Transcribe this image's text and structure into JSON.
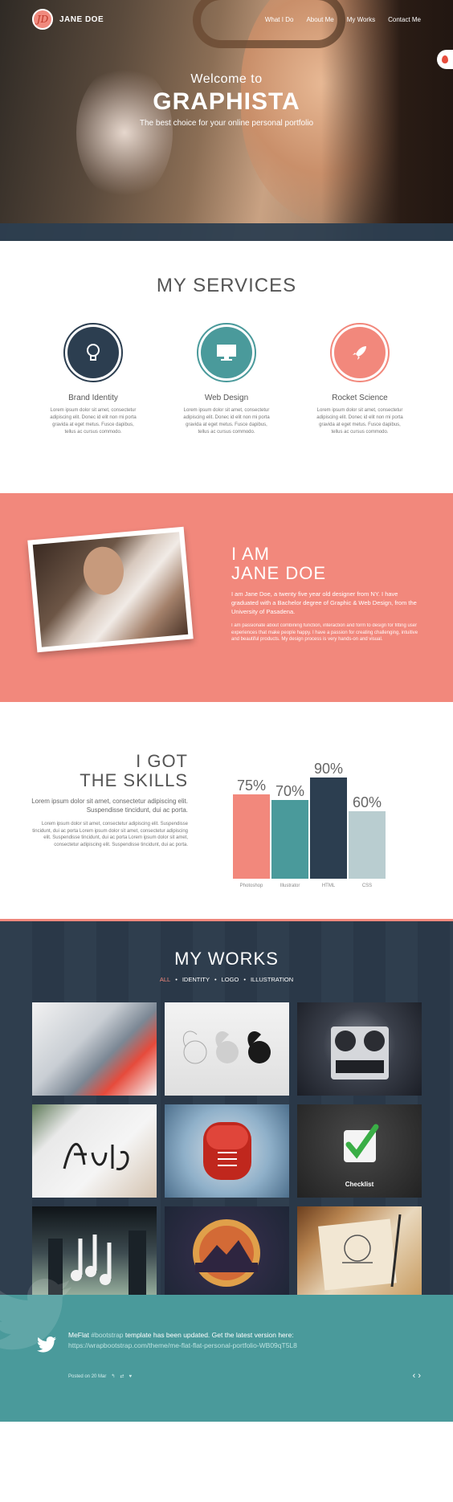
{
  "nav": {
    "logo_initials": "JD",
    "brand": "JANE DOE",
    "items": [
      "What I Do",
      "About Me",
      "My Works",
      "Contact Me"
    ]
  },
  "hero": {
    "welcome": "Welcome to",
    "title": "GRAPHISTA",
    "subtitle": "The best choice for your online personal portfolio"
  },
  "services": {
    "title": "MY SERVICES",
    "items": [
      {
        "label": "Brand Identity",
        "icon": "lightbulb-icon",
        "color": "#2c3e50",
        "text": "Lorem ipsum dolor sit amet, consectetur adipiscing elit. Donec id elit non mi porta gravida at eget metus. Fusce dapibus, tellus ac cursus commodo."
      },
      {
        "label": "Web Design",
        "icon": "monitor-icon",
        "color": "#4a9a9b",
        "text": "Lorem ipsum dolor sit amet, consectetur adipiscing elit. Donec id elit non mi porta gravida at eget metus. Fusce dapibus, tellus ac cursus commodo."
      },
      {
        "label": "Rocket Science",
        "icon": "rocket-icon",
        "color": "#f2887c",
        "text": "Lorem ipsum dolor sit amet, consectetur adipiscing elit. Donec id elit non mi porta gravida at eget metus. Fusce dapibus, tellus ac cursus commodo."
      }
    ]
  },
  "about": {
    "heading_1": "I AM",
    "heading_2": "JANE DOE",
    "p1": "I am Jane Doe, a twenty five year old designer from NY. I have graduated with a Bachelor degree of Graphic & Web Design, from the University of Pasadena.",
    "p2": "I am passionate about combining function, interaction and form to design for fitting user experiences that make people happy. I have a passion for creating challenging, intuitive and beautiful products. My design process is very hands-on and visual."
  },
  "skills": {
    "heading_1": "I GOT",
    "heading_2": "THE SKILLS",
    "p1": "Lorem ipsum dolor sit amet, consectetur adipiscing elit. Suspendisse tincidunt, dui ac porta.",
    "p2": "Lorem ipsum dolor sit amet, consectetur adipiscing elit. Suspendisse tincidunt, dui ac porta Lorem ipsum dolor sit amet, consectetur adipiscing elit. Suspendisse tincidunt, dui ac porta Lorem ipsum dolor sit amet, consectetur adipiscing elit. Suspendisse tincidunt, dui ac porta."
  },
  "chart_data": {
    "type": "bar",
    "categories": [
      "Photoshop",
      "Illustrator",
      "HTML",
      "CSS"
    ],
    "values": [
      75,
      70,
      90,
      60
    ],
    "value_labels": [
      "75%",
      "70%",
      "90%",
      "60%"
    ],
    "colors": [
      "#f2887c",
      "#4a9a9b",
      "#2c3e50",
      "#b9cdd0"
    ],
    "ylim": [
      0,
      100
    ]
  },
  "works": {
    "title": "MY WORKS",
    "filters": [
      "ALL",
      "IDENTITY",
      "LOGO",
      "ILLUSTRATION"
    ],
    "tile_label": "Checklist"
  },
  "tweet": {
    "text_1": "MeFlat",
    "hashtag": "#bootstrap",
    "text_2": "template has been updated. Get the latest version here:",
    "link": "https://wrapbootstrap.com/theme/me-flat-flat-personal-portfolio-WB09qT5L8",
    "meta": "Posted on 20 Mar"
  }
}
